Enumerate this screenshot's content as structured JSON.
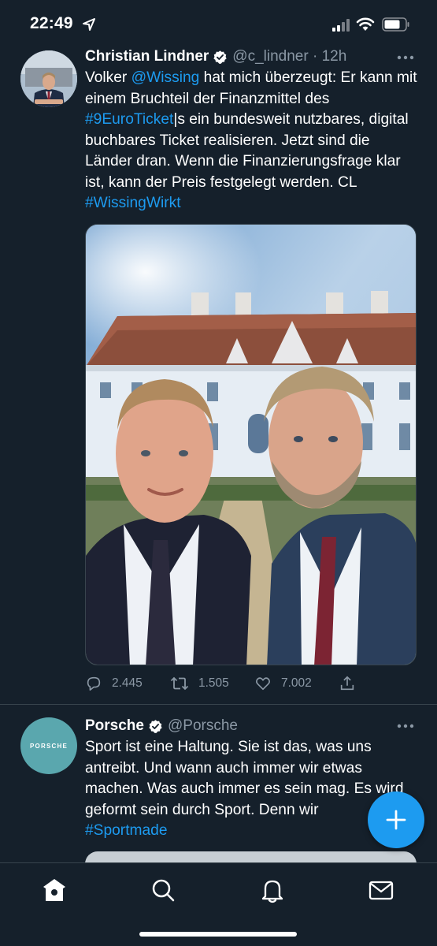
{
  "status_bar": {
    "time": "22:49"
  },
  "tweets": [
    {
      "author": "Christian Lindner",
      "handle": "@c_lindner · 12h",
      "text_parts": {
        "p1": "Volker ",
        "mention": "@Wissing",
        "p2": " hat mich überzeugt: Er kann mit einem Bruchteil der Finanzmittel des ",
        "hashtag1": "#9EuroTicket",
        "p3": "|s ein bundesweit nutzbares, digital buchbares Ticket realisieren. Jetzt sind die Länder dran. Wenn die Finanzierungsfrage klar ist, kann der Preis festgelegt werden. CL ",
        "hashtag2": "#WissingWirkt"
      },
      "replies": "2.445",
      "retweets": "1.505",
      "likes": "7.002"
    },
    {
      "author": "Porsche",
      "handle": "@Porsche",
      "avatar_text": "PORSCHE",
      "text_parts": {
        "p1": "Sport ist eine Haltung. Sie ist das, was uns antreibt. Und wann auch immer wir etwas machen. Was auch immer es sein mag. Es wird geformt sein durch Sport. Denn wir ",
        "hashtag1": "#Sportmade"
      }
    }
  ],
  "icons": {
    "status": [
      "location-arrow-icon",
      "signal-icon",
      "wifi-icon",
      "battery-icon"
    ],
    "tweet": [
      "verified-icon",
      "more-icon",
      "reply-icon",
      "retweet-icon",
      "like-icon",
      "share-icon"
    ],
    "tabs": [
      "home-icon",
      "search-icon",
      "notifications-icon",
      "messages-icon"
    ],
    "fab": "compose-plus-icon"
  },
  "colors": {
    "background": "#15202b",
    "accent": "#1d9bf0",
    "secondary_text": "#8b98a5",
    "divider": "#38444d"
  }
}
